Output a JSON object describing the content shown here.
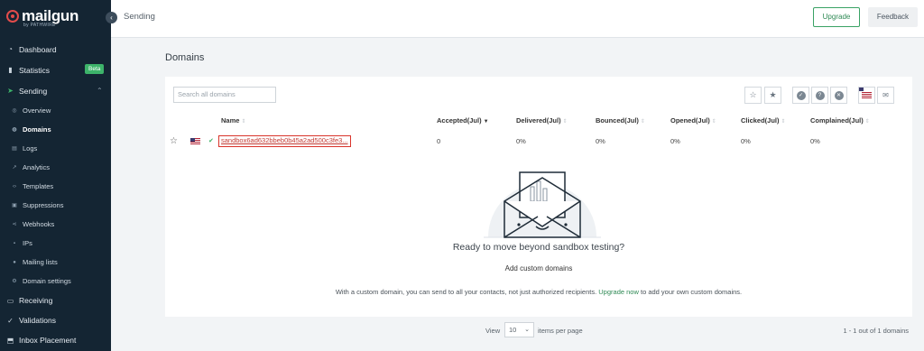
{
  "brand": {
    "name": "mailgun",
    "sub": "by PATHWIRE"
  },
  "sidebar": {
    "items": [
      {
        "label": "Dashboard",
        "icon": "dashboard-icon"
      },
      {
        "label": "Statistics",
        "icon": "bar-chart-icon",
        "badge": "Beta"
      },
      {
        "label": "Sending",
        "icon": "send-icon"
      }
    ],
    "sending_sub": [
      {
        "label": "Overview"
      },
      {
        "label": "Domains"
      },
      {
        "label": "Logs"
      },
      {
        "label": "Analytics"
      },
      {
        "label": "Templates"
      },
      {
        "label": "Suppressions"
      },
      {
        "label": "Webhooks"
      },
      {
        "label": "IPs"
      },
      {
        "label": "Mailing lists"
      },
      {
        "label": "Domain settings"
      }
    ],
    "bottom": [
      {
        "label": "Receiving",
        "icon": "inbox-icon"
      },
      {
        "label": "Validations",
        "icon": "check-user-icon"
      },
      {
        "label": "Inbox Placement",
        "icon": "mailbox-icon"
      }
    ]
  },
  "topbar": {
    "breadcrumb": "Sending",
    "upgrade": "Upgrade",
    "feedback": "Feedback"
  },
  "page": {
    "title": "Domains"
  },
  "search": {
    "placeholder": "Search all domains"
  },
  "table": {
    "headers": [
      "Name",
      "Accepted(Jul)",
      "Delivered(Jul)",
      "Bounced(Jul)",
      "Opened(Jul)",
      "Clicked(Jul)",
      "Complained(Jul)"
    ],
    "rows": [
      {
        "name": "sandbox6ad632bbeb0b45a2ad500c3fe3...",
        "accepted": "0",
        "delivered": "0%",
        "bounced": "0%",
        "opened": "0%",
        "clicked": "0%",
        "complained": "0%"
      }
    ]
  },
  "empty": {
    "title": "Ready to move beyond sandbox testing?",
    "link": "Add custom domains",
    "desc_before": "With a custom domain, you can send to all your contacts, not just authorized recipients.",
    "desc_link": "Upgrade now",
    "desc_after": "to add your own custom domains."
  },
  "pager": {
    "view": "View",
    "per_page": "10",
    "items_label": "items per page",
    "count": "1 - 1 out of 1 domains"
  },
  "colors": {
    "sidebar": "#142533",
    "accent": "#3aa265",
    "highlight": "#d9342b"
  }
}
